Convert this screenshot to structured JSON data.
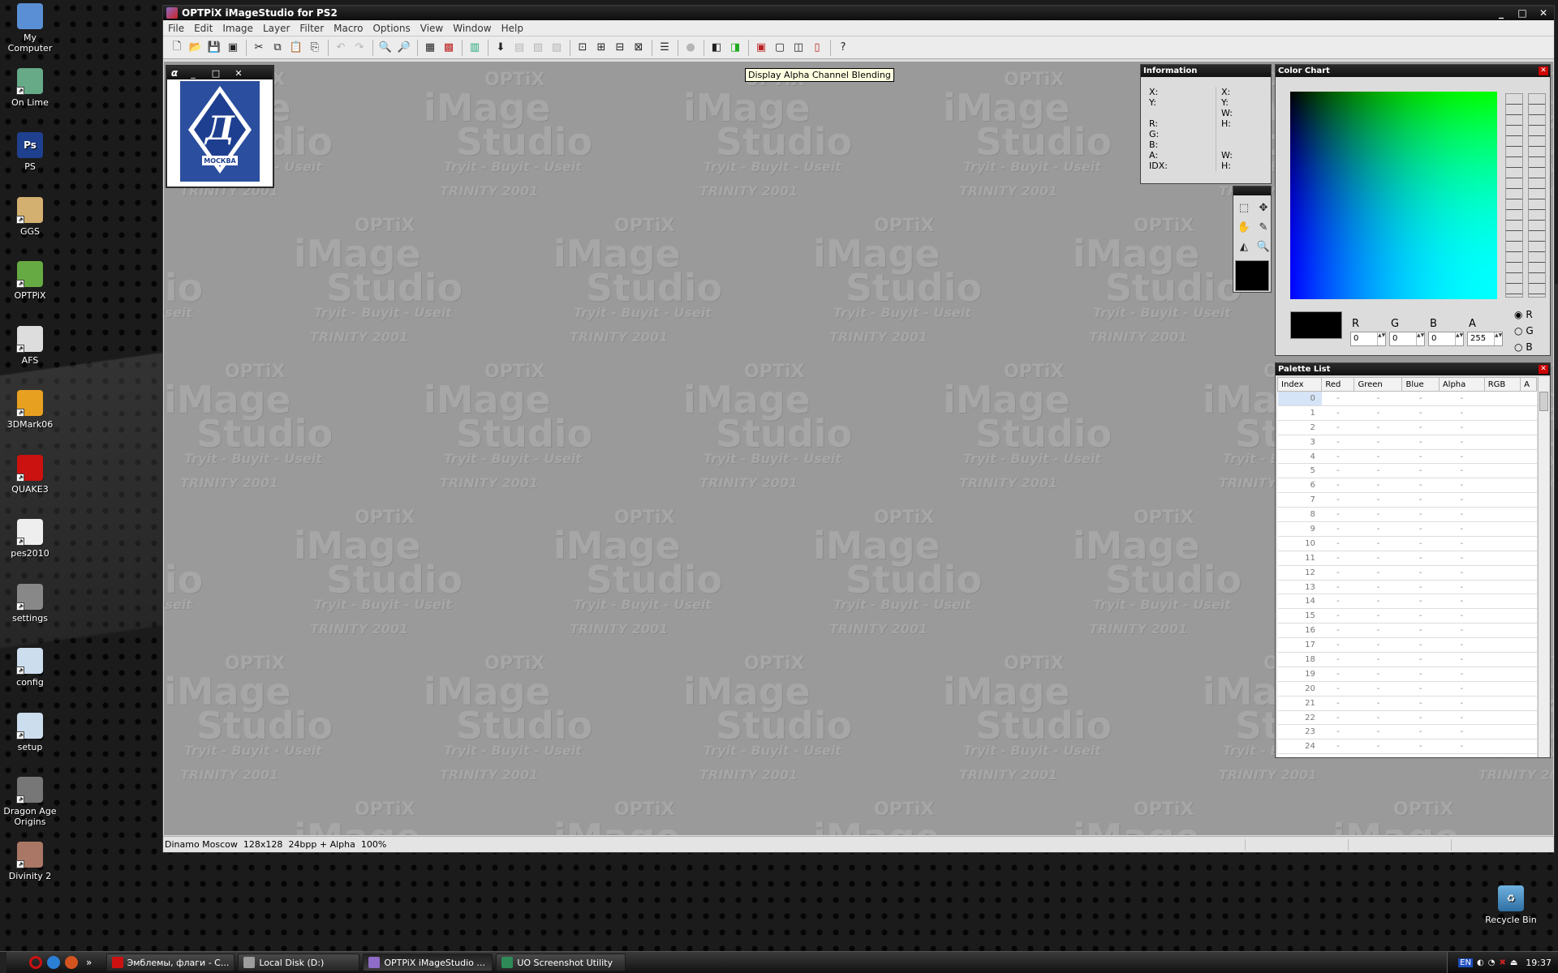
{
  "desktop": {
    "icons": [
      {
        "label": "My Computer",
        "glyph": "computer-icon"
      },
      {
        "label": "On Lime",
        "glyph": "onlime-icon"
      },
      {
        "label": "PS",
        "glyph": "photoshop-icon",
        "badge": "Ps"
      },
      {
        "label": "GGS",
        "glyph": "ggs-icon"
      },
      {
        "label": "OPTPiX",
        "glyph": "optpix-icon"
      },
      {
        "label": "AFS",
        "glyph": "ball-icon"
      },
      {
        "label": "3DMark06",
        "glyph": "3dmark-icon"
      },
      {
        "label": "QUAKE3",
        "glyph": "quake-icon"
      },
      {
        "label": "pes2010",
        "glyph": "pes-icon"
      },
      {
        "label": "settings",
        "glyph": "settings-icon"
      },
      {
        "label": "config",
        "glyph": "window-icon"
      },
      {
        "label": "setup",
        "glyph": "window-icon"
      },
      {
        "label": "Dragon Age Origins",
        "glyph": "dragon-age-icon"
      },
      {
        "label": "Divinity 2",
        "glyph": "divinity-icon"
      }
    ],
    "recycle_bin": "Recycle Bin"
  },
  "app": {
    "title": "OPTPiX iMageStudio for PS2",
    "window_controls": [
      "_",
      "□",
      "✕"
    ],
    "menu": [
      "File",
      "Edit",
      "Image",
      "Layer",
      "Filter",
      "Macro",
      "Options",
      "View",
      "Window",
      "Help"
    ],
    "tooltip": "Display Alpha Channel Blending",
    "watermark": {
      "logo": "OPTiX",
      "brand1": "iMage",
      "brand2": "Studio",
      "tag": "Tryit - Buyit - Useit",
      "crack": "TRINITY 2001"
    },
    "status": {
      "name": "Dinamo Moscow",
      "size": "128x128",
      "depth": "24bpp + Alpha",
      "zoom": "100%"
    }
  },
  "image_window": {
    "logo_text": "МОСКВА"
  },
  "info_panel": {
    "title": "Information",
    "left": [
      "X:",
      "Y:",
      "R:",
      "G:",
      "B:",
      "A:",
      "IDX:"
    ],
    "right_top": [
      "X:",
      "Y:",
      "W:",
      "H:"
    ],
    "right_bottom": [
      "W:",
      "H:"
    ]
  },
  "color_chart": {
    "title": "Color Chart",
    "labels": [
      "R",
      "G",
      "B",
      "A"
    ],
    "values": [
      "0",
      "0",
      "0",
      "255"
    ],
    "radio": [
      "R",
      "G",
      "B"
    ],
    "selected": "R"
  },
  "palette": {
    "title": "Palette List",
    "columns": [
      "Index",
      "Red",
      "Green",
      "Blue",
      "Alpha",
      "RGB",
      "A"
    ],
    "rows": [
      "0",
      "1",
      "2",
      "3",
      "4",
      "5",
      "6",
      "7",
      "8",
      "9",
      "10",
      "11",
      "12",
      "13",
      "14",
      "15",
      "16",
      "17",
      "18",
      "19",
      "20",
      "21",
      "22",
      "23",
      "24"
    ],
    "empty": "-"
  },
  "taskbar": {
    "tasks": [
      {
        "label": "Эмблемы, флаги - C...",
        "color": "#cc1111"
      },
      {
        "label": "Local Disk (D:)",
        "color": "#9c9c9c"
      },
      {
        "label": "OPTPiX iMageStudio ...",
        "color": "#8e6cc7",
        "active": true
      },
      {
        "label": "UO Screenshot Utility",
        "color": "#2e8b57"
      }
    ],
    "quick_chevron": "»",
    "lang": "EN",
    "clock": "19:37"
  }
}
